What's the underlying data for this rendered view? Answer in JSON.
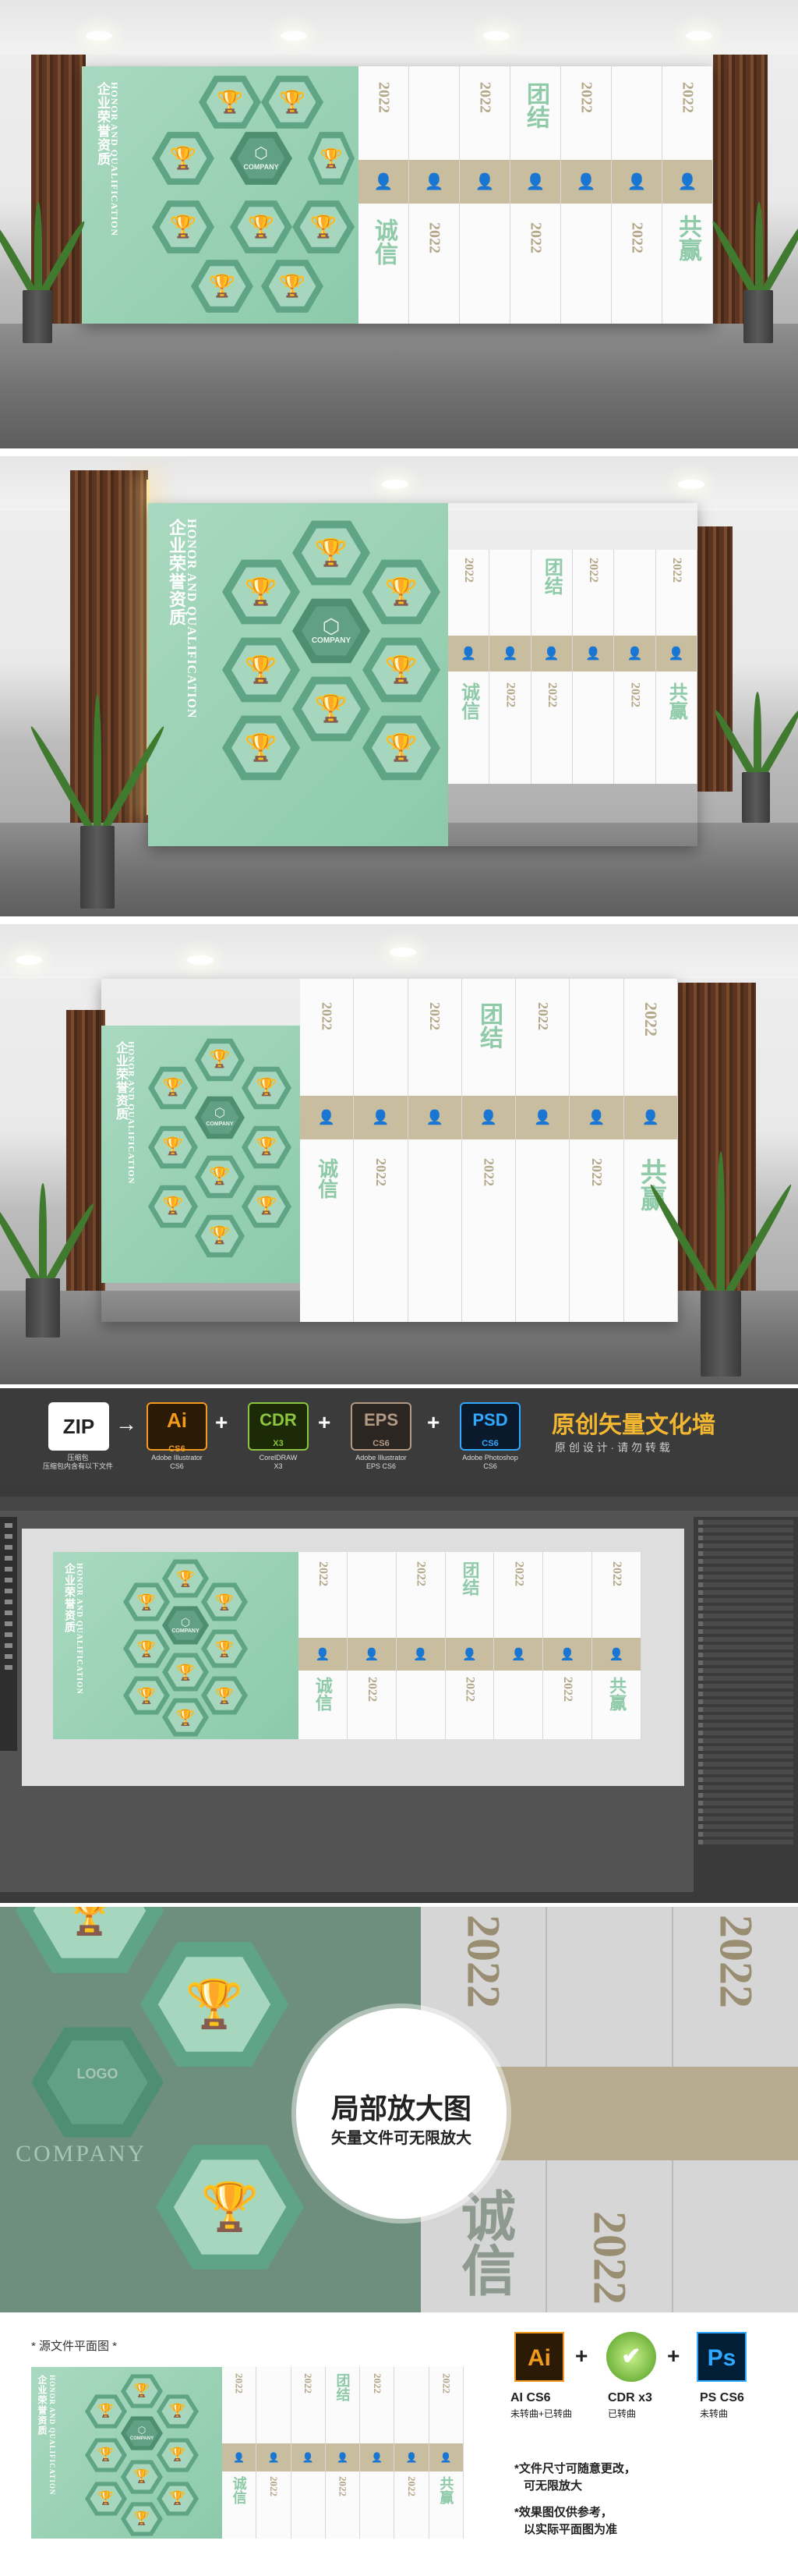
{
  "wall": {
    "title_cn": "企业荣誉资质",
    "title_en": "HONOR AND QUALIFICATION",
    "company": "COMPANY",
    "year": "2022",
    "word1": "团结",
    "word2": "诚信",
    "word3": "共赢",
    "trophy_icon": "trophy-icon",
    "person_icon": "person-icon",
    "colors": {
      "green": "#9fd3b7",
      "dark_green": "#4e8f72",
      "beige": "#c9bda0",
      "year": "#b4a88a"
    }
  },
  "formats": {
    "zip": {
      "label": "ZIP",
      "caption": "压缩包",
      "note": "压缩包内含有以下文件"
    },
    "ai": {
      "label": "Ai",
      "sub": "CS6",
      "app": "Adobe Illustrator",
      "ver": "CS6"
    },
    "cdr": {
      "label": "CDR",
      "sub": "X3",
      "app": "CorelDRAW",
      "ver": "X3"
    },
    "eps": {
      "label": "EPS",
      "sub": "CS6",
      "app": "Adobe Illustrator",
      "ver": "EPS CS6"
    },
    "psd": {
      "label": "PSD",
      "sub": "CS6",
      "app": "Adobe Photoshop",
      "ver": "CS6"
    },
    "headline": "原创矢量文化墙",
    "subline": "原 创 设 计 · 请 勿 转 载"
  },
  "zoom": {
    "title": "局部放大图",
    "subtitle": "矢量文件可无限放大",
    "logo": "LOGO",
    "company": "COMPANY",
    "year": "2022",
    "word": "诚信"
  },
  "source": {
    "heading": "* 源文件平面图 *",
    "tools": [
      {
        "label": "Ai",
        "name": "AI CS6",
        "status": "未转曲+已转曲"
      },
      {
        "label": "CDR",
        "name": "CDR x3",
        "status": "已转曲"
      },
      {
        "label": "Ps",
        "name": "PS CS6",
        "status": "未转曲"
      }
    ],
    "notes": [
      "*文件尺寸可随意更改，",
      "可无限放大",
      "*效果图仅供参考，",
      "以实际平面图为准"
    ]
  }
}
